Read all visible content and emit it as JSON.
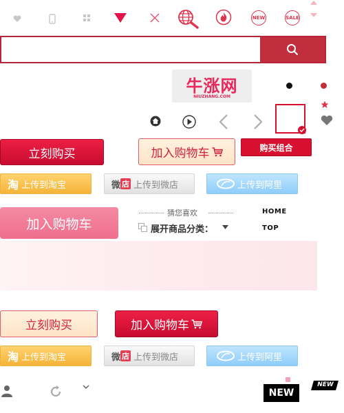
{
  "top_icons": {
    "new_badge": "NEW",
    "sale_badge": "SALE"
  },
  "search": {
    "value": "",
    "placeholder": ""
  },
  "logo": {
    "main": "牛涨网",
    "sub": "NIUZHANG.COM"
  },
  "buttons": {
    "buy_now": "立刻购买",
    "add_cart": "加入购物车",
    "combo": "购买组合",
    "add_cart_pink": "加入购物车",
    "buy_now_2": "立刻购买",
    "add_cart_2": "加入购物车"
  },
  "share": {
    "taobao_tag": "淘",
    "taobao": "上传到淘宝",
    "weidian_tag_1": "微",
    "weidian_tag_2": "店",
    "weidian": "上传到微店",
    "aliyun": "上传到阿里"
  },
  "guess": {
    "title": "猜您喜欢",
    "expand": "展开商品分类："
  },
  "links": {
    "home": "HOME",
    "top": "TOP"
  },
  "badges": {
    "new_dark": "NEW",
    "new_italic": "NEW"
  },
  "colors": {
    "brand_red": "#c12e3c",
    "pink_accent": "#e0334e"
  }
}
